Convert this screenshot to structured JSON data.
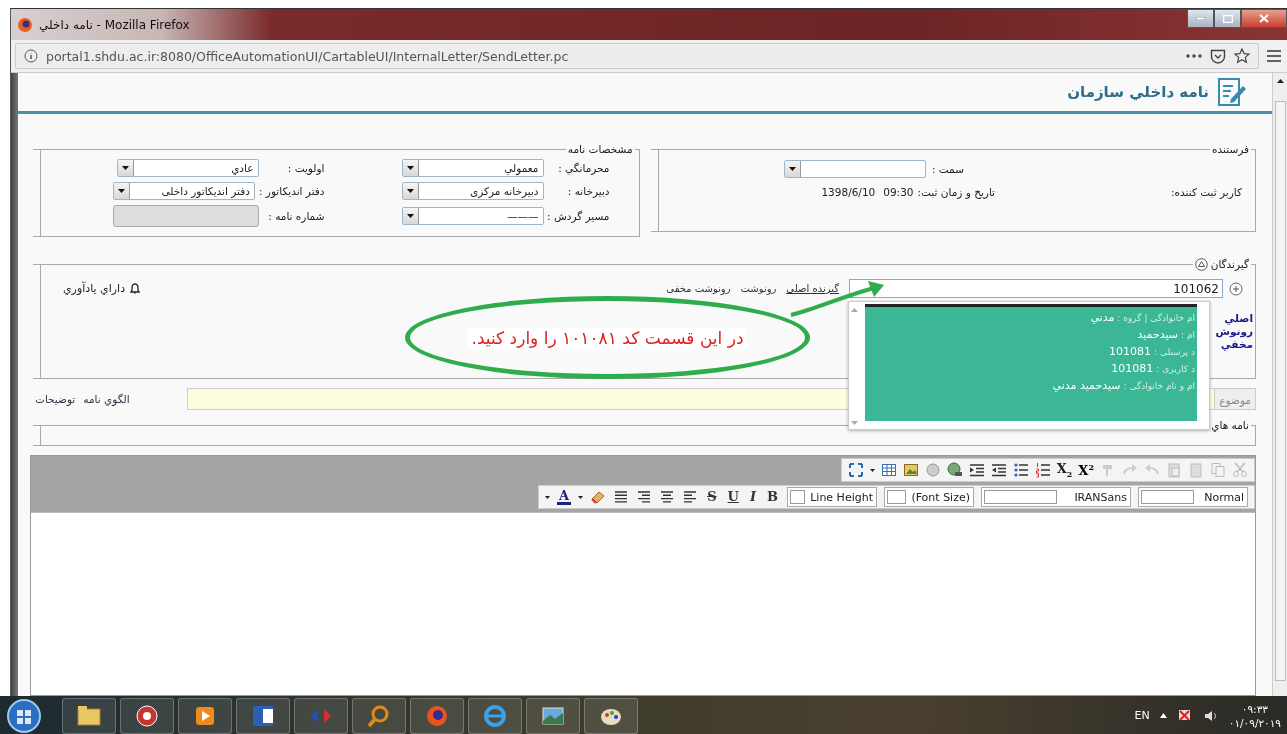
{
  "window": {
    "title": "نامه داخلي - Mozilla Firefox"
  },
  "address_bar": {
    "url": "portal1.shdu.ac.ir:8080/OfficeAutomationUI/CartableUI/InternalLetter/SendLetter.pc"
  },
  "page_header": {
    "title": "نامه داخلي سازمان"
  },
  "letter_details": {
    "legend": "مشخصات نامه",
    "fields": [
      {
        "label": "محرمانگي :",
        "value": "معمولي",
        "kind": "select"
      },
      {
        "label": "اولويت :",
        "value": "عادي",
        "kind": "select"
      },
      {
        "label": "دبيرخانه :",
        "value": "دبيرخانه مرکزی",
        "kind": "select"
      },
      {
        "label": "دفتر انديکاتور :",
        "value": "دفتر انديکاتور داخلی",
        "kind": "select"
      },
      {
        "label": "مسير گردش :",
        "value": "———",
        "kind": "select"
      },
      {
        "label": "شماره نامه :",
        "kind": "readonly"
      }
    ]
  },
  "sender": {
    "legend": "فرستنده",
    "position_label": "سمت :",
    "registrar_label": "کاربر ثبت کننده:",
    "datetime_label": "تاريخ و زمان ثبت:",
    "time": "09:30",
    "date": "1398/6/10"
  },
  "recipients": {
    "legend": "گيرندگان",
    "expanded": true,
    "search_value": "101062",
    "recipient_types": [
      {
        "label": "گيرنده اصلی",
        "selected": true
      },
      {
        "label": "رونوشت",
        "selected": false
      },
      {
        "label": "رونوشت مخفی",
        "selected": false
      }
    ],
    "lists": [
      "اصلي",
      "رونوش",
      "مخفي"
    ],
    "reminder": "داراي يادآوري"
  },
  "suggestions": {
    "rows": [
      {
        "label": "ام خانوادگی | گروه :",
        "value": "مدني"
      },
      {
        "label": "ام :",
        "value": "سيدحميد"
      },
      {
        "label": "د پرسنلی :",
        "value": "101081"
      },
      {
        "label": "د کاربری :",
        "value": "101081"
      },
      {
        "label": "ام و نام خانوادگی :",
        "value": "سيدحميد مدني"
      }
    ]
  },
  "callout": {
    "text": "در اين قسمت کد ۱۰۱۰۸۱ را وارد کنيد."
  },
  "subject": {
    "label": "موضوع",
    "links": [
      "الگوي نامه",
      "توضيحات"
    ]
  },
  "related": {
    "legend": "نامه هاي"
  },
  "editor": {
    "script_buttons": [
      {
        "kind": "superscript",
        "label": "X$^{2}$"
      },
      {
        "kind": "subscript",
        "label": "X$_{2}$"
      }
    ],
    "format_buttons": [
      {
        "kind": "bold",
        "label": "B"
      },
      {
        "kind": "italic",
        "label": "I"
      },
      {
        "kind": "underline",
        "label": "U"
      },
      {
        "kind": "strike",
        "label": "S"
      },
      {
        "kind": "color",
        "label": "A"
      }
    ],
    "selects": [
      {
        "value": "Normal"
      },
      {
        "value": "IRANSans"
      },
      {
        "value": "(Font Size)"
      },
      {
        "value": "Line Height"
      }
    ]
  },
  "taskbar": {
    "language": "EN",
    "time": "۰۹:۳۳",
    "date": "۰۱/۰۹/۲۰۱۹"
  }
}
